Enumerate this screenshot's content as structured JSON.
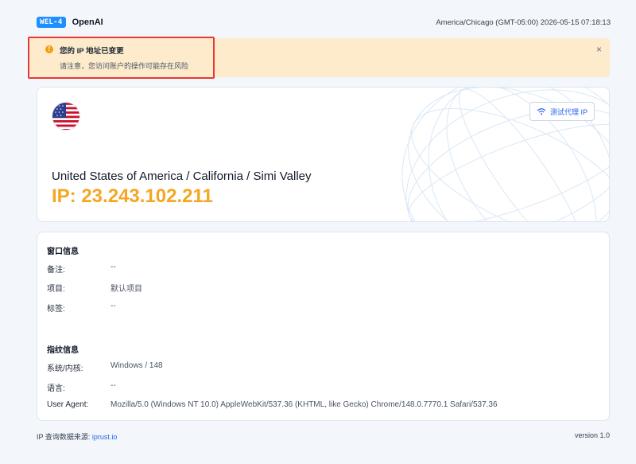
{
  "header": {
    "badge": "WEL-4",
    "app_name": "OpenAI",
    "timezone_time": "America/Chicago (GMT-05:00) 2026-05-15 07:18:13"
  },
  "alert": {
    "icon_text": "!",
    "title": "您的 IP 地址已变更",
    "description": "请注意，您访问账户的操作可能存在风险",
    "close": "×"
  },
  "ip_card": {
    "flag": "us-flag-icon",
    "test_proxy_label": "测试代理 IP",
    "location": "United States of America / California / Simi Valley",
    "ip_label": "IP: 23.243.102.211"
  },
  "window_info": {
    "title": "窗口信息",
    "rows": [
      {
        "label": "备注:",
        "value": "--"
      },
      {
        "label": "项目:",
        "value": "默认项目"
      },
      {
        "label": "标签:",
        "value": "--"
      }
    ]
  },
  "fingerprint_info": {
    "title": "指纹信息",
    "rows": [
      {
        "label": "系统/内核:",
        "value": "Windows / 148"
      },
      {
        "label": "语言:",
        "value": "--"
      },
      {
        "label": "User Agent:",
        "value": "Mozilla/5.0 (Windows NT 10.0) AppleWebKit/537.36 (KHTML, like Gecko) Chrome/148.0.7770.1 Safari/537.36"
      }
    ]
  },
  "footer": {
    "source_label": "IP 查询数据来源: ",
    "source_link": "iprust.io",
    "version": "version 1.0"
  },
  "colors": {
    "accent": "#1d8fff",
    "ip_orange": "#f5a623",
    "alert_bg": "#fdebcc",
    "highlight_red": "#e53935"
  }
}
